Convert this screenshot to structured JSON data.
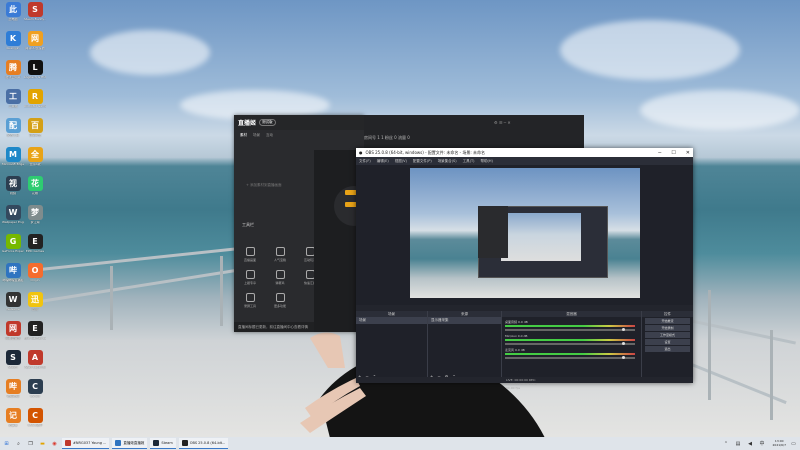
{
  "desktop_icons": [
    {
      "label": "此电脑",
      "icon": "computer-icon",
      "color": "#3b7bd6"
    },
    {
      "label": "Steam Buddy…",
      "icon": "steam-buddy-icon",
      "color": "#c0392b"
    },
    {
      "label": "Kuangjin",
      "icon": "k-icon",
      "color": "#2e7dd7"
    },
    {
      "label": "网易UU加速器",
      "icon": "uu-icon",
      "color": "#f0a020"
    },
    {
      "label": "腾讯云网关",
      "icon": "cloud-icon",
      "color": "#e67e22"
    },
    {
      "label": "Logitech G HUB",
      "icon": "logitech-icon",
      "color": "#111111"
    },
    {
      "label": "工具箱",
      "icon": "toolbox-icon",
      "color": "#4a6fa5"
    },
    {
      "label": "Rockstar Games",
      "icon": "rockstar-icon",
      "color": "#e2a400"
    },
    {
      "label": "配置工具",
      "icon": "config-icon",
      "color": "#5a9fd4"
    },
    {
      "label": "百度网盘",
      "icon": "baidu-icon",
      "color": "#d4a017"
    },
    {
      "label": "Microsoft Edge",
      "icon": "edge-icon",
      "color": "#1e88c8"
    },
    {
      "label": "全民K歌",
      "icon": "music-icon",
      "color": "#e8a317"
    },
    {
      "label": "视频",
      "icon": "video-icon",
      "color": "#2c3e50"
    },
    {
      "label": "花椒",
      "icon": "flower-icon",
      "color": "#2ecc71"
    },
    {
      "label": "Wallpaper Engine",
      "icon": "wallpaper-icon",
      "color": "#34495e"
    },
    {
      "label": "梦江湖",
      "icon": "game-icon",
      "color": "#7f8c8d"
    },
    {
      "label": "GeForce Experience",
      "icon": "nvidia-icon",
      "color": "#76b900"
    },
    {
      "label": "EPIC Games",
      "icon": "cam-icon",
      "color": "#222222"
    },
    {
      "label": "哔哩哔哩直播姬",
      "icon": "bilibili-icon",
      "color": "#2f74c0"
    },
    {
      "label": "Origin",
      "icon": "origin-icon",
      "color": "#f56c2d"
    },
    {
      "label": "WeGame",
      "icon": "wegame-icon",
      "color": "#333333"
    },
    {
      "label": "迅雷",
      "icon": "thunder-icon",
      "color": "#f1c40f"
    },
    {
      "label": "网易云音乐",
      "icon": "netease-icon",
      "color": "#c0392b"
    },
    {
      "label": "Epic Games Launcher",
      "icon": "epic-icon",
      "color": "#222222"
    },
    {
      "label": "Steam",
      "icon": "steam-icon",
      "color": "#1b2838"
    },
    {
      "label": "Apex Legends",
      "icon": "apex-icon",
      "color": "#c0392b"
    },
    {
      "label": "哔哩哔哩",
      "icon": "tv-icon",
      "color": "#e67e22"
    },
    {
      "label": "CS:GO",
      "icon": "csgo-icon",
      "color": "#2c3e50"
    },
    {
      "label": "记事本",
      "icon": "notepad-icon",
      "color": "#e67e22"
    },
    {
      "label": "CSGO助手",
      "icon": "cs-icon",
      "color": "#d35400"
    }
  ],
  "livehime": {
    "logo": "直播姬",
    "badge": "测试版",
    "tabs": [
      "素材",
      "场景",
      "互动"
    ],
    "empty_hint": "+ 添加素材到直播画面",
    "tools_title": "工具栏",
    "tools": [
      "直播画面",
      "人气宝箱",
      "互动玩法",
      "上舰专享",
      "弹幕鸡",
      "快速汇报",
      "录屏工具",
      "更多功能"
    ],
    "footer": "直播间标题已更新，前往直播间中心查看详情",
    "room_info": "房间号 1 1 粉丝 0 流量 0",
    "stream_btn": "开始直播",
    "record_btn": "录制"
  },
  "obs": {
    "title": "OBS 25.0.8 (64-bit, windows) - 配置文件: 未命名 - 场景: 未命名",
    "menu": [
      "文件(F)",
      "编辑(E)",
      "视图(V)",
      "配置文件(P)",
      "场景集合(S)",
      "工具(T)",
      "帮助(H)"
    ],
    "docks": {
      "scenes": {
        "title": "场景",
        "items": [
          "场景"
        ]
      },
      "sources": {
        "title": "来源",
        "items": [
          "显示器采集"
        ]
      },
      "mixer": {
        "title": "混音器",
        "tracks": [
          {
            "name": "桌面音频",
            "db": "0.0 dB"
          },
          {
            "name": "Mic/Aux",
            "db": "0.0 dB"
          },
          {
            "name": "麦克风",
            "db": "0.0 dB"
          }
        ]
      },
      "controls": {
        "title": "控件",
        "buttons": [
          "开始推流",
          "开始录制",
          "工作室模式",
          "设置",
          "退出"
        ]
      }
    },
    "status": "LIVE: 00:00:00  REC: 00:00:00  CPU: 1.6%, 60.00 fps"
  },
  "taskbar": {
    "apps": [
      {
        "label": "#NRG037 Young ...",
        "color": "#c0392b"
      },
      {
        "label": "直播姬直播姬",
        "color": "#2f74c0"
      },
      {
        "label": "Steam",
        "color": "#1b2838"
      },
      {
        "label": "OBS 25.0.8 (64-bit...",
        "color": "#222222"
      }
    ],
    "time": "13:00",
    "date": "2021/6/7"
  }
}
